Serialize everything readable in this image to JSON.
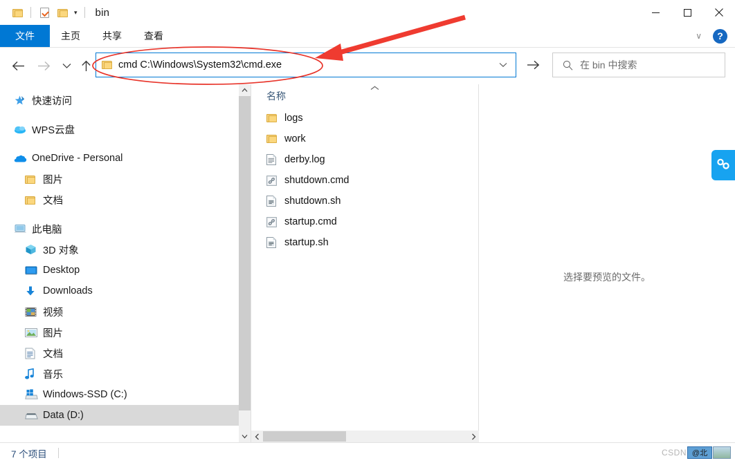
{
  "window": {
    "title": "bin",
    "quick_access": [
      {
        "name": "folder-icon",
        "label": ""
      },
      {
        "name": "properties-icon",
        "label": ""
      },
      {
        "name": "new-folder-icon",
        "label": ""
      },
      {
        "name": "customize-caret-icon",
        "label": "▾"
      }
    ],
    "controls": {
      "minimize": "—",
      "maximize": "□",
      "close": "✕"
    }
  },
  "ribbon": {
    "tabs": [
      {
        "label": "文件",
        "active": true
      },
      {
        "label": "主页",
        "active": false
      },
      {
        "label": "共享",
        "active": false
      },
      {
        "label": "查看",
        "active": false
      }
    ],
    "collapse_icon": "∨",
    "help_label": "?"
  },
  "nav": {
    "back_icon": "←",
    "forward_icon": "→",
    "recent_icon": "∨",
    "up_icon": "↑",
    "address_value": "cmd C:\\Windows\\System32\\cmd.exe",
    "address_chevron": "∨",
    "go_icon": "→"
  },
  "search": {
    "placeholder": "在 bin 中搜索",
    "icon": "search-icon"
  },
  "sidebar": {
    "items": [
      {
        "label": "快速访问",
        "icon": "pin-star-icon",
        "indent": 0,
        "selected": false,
        "gap_after": true
      },
      {
        "label": "WPS云盘",
        "icon": "wps-cloud-icon",
        "indent": 0,
        "selected": false,
        "gap_after": true
      },
      {
        "label": "OneDrive - Personal",
        "icon": "onedrive-cloud-icon",
        "indent": 0,
        "selected": false,
        "gap_after": false
      },
      {
        "label": "图片",
        "icon": "folder-icon",
        "indent": 1,
        "selected": false,
        "gap_after": false
      },
      {
        "label": "文档",
        "icon": "folder-icon",
        "indent": 1,
        "selected": false,
        "gap_after": true
      },
      {
        "label": "此电脑",
        "icon": "this-pc-icon",
        "indent": 0,
        "selected": false,
        "gap_after": false
      },
      {
        "label": "3D 对象",
        "icon": "3d-objects-icon",
        "indent": 1,
        "selected": false,
        "gap_after": false
      },
      {
        "label": "Desktop",
        "icon": "desktop-icon",
        "indent": 1,
        "selected": false,
        "gap_after": false
      },
      {
        "label": "Downloads",
        "icon": "downloads-icon",
        "indent": 1,
        "selected": false,
        "gap_after": false
      },
      {
        "label": "视频",
        "icon": "videos-icon",
        "indent": 1,
        "selected": false,
        "gap_after": false
      },
      {
        "label": "图片",
        "icon": "pictures-icon",
        "indent": 1,
        "selected": false,
        "gap_after": false
      },
      {
        "label": "文档",
        "icon": "documents-icon",
        "indent": 1,
        "selected": false,
        "gap_after": false
      },
      {
        "label": "音乐",
        "icon": "music-icon",
        "indent": 1,
        "selected": false,
        "gap_after": false
      },
      {
        "label": "Windows-SSD (C:)",
        "icon": "windows-drive-icon",
        "indent": 1,
        "selected": false,
        "gap_after": false
      },
      {
        "label": "Data (D:)",
        "icon": "drive-icon",
        "indent": 1,
        "selected": true,
        "gap_after": false
      }
    ],
    "scroll_up_icon": "∧",
    "scroll_down_icon": "∨"
  },
  "filelist": {
    "column_header": "名称",
    "sort_icon": "∧",
    "rows": [
      {
        "name": "logs",
        "icon": "folder-icon"
      },
      {
        "name": "work",
        "icon": "folder-icon"
      },
      {
        "name": "derby.log",
        "icon": "text-file-icon"
      },
      {
        "name": "shutdown.cmd",
        "icon": "cmd-script-icon"
      },
      {
        "name": "shutdown.sh",
        "icon": "sh-file-icon"
      },
      {
        "name": "startup.cmd",
        "icon": "cmd-script-icon"
      },
      {
        "name": "startup.sh",
        "icon": "sh-file-icon"
      }
    ],
    "hscroll_left_icon": "‹",
    "hscroll_right_icon": "›"
  },
  "preview": {
    "empty_text": "选择要预览的文件。",
    "widget_icon": "link-nodes-icon"
  },
  "statusbar": {
    "item_count": "7 个项目"
  },
  "watermark": {
    "text": "CSDN",
    "badge": "@北"
  },
  "colors": {
    "accent": "#0078d4",
    "tab_active_bg": "#0078d4",
    "selection": "#d9d9d9",
    "annotation_red": "#e8342a",
    "folder_yellow": "#fbd77e",
    "widget_blue": "#17a3f0"
  }
}
